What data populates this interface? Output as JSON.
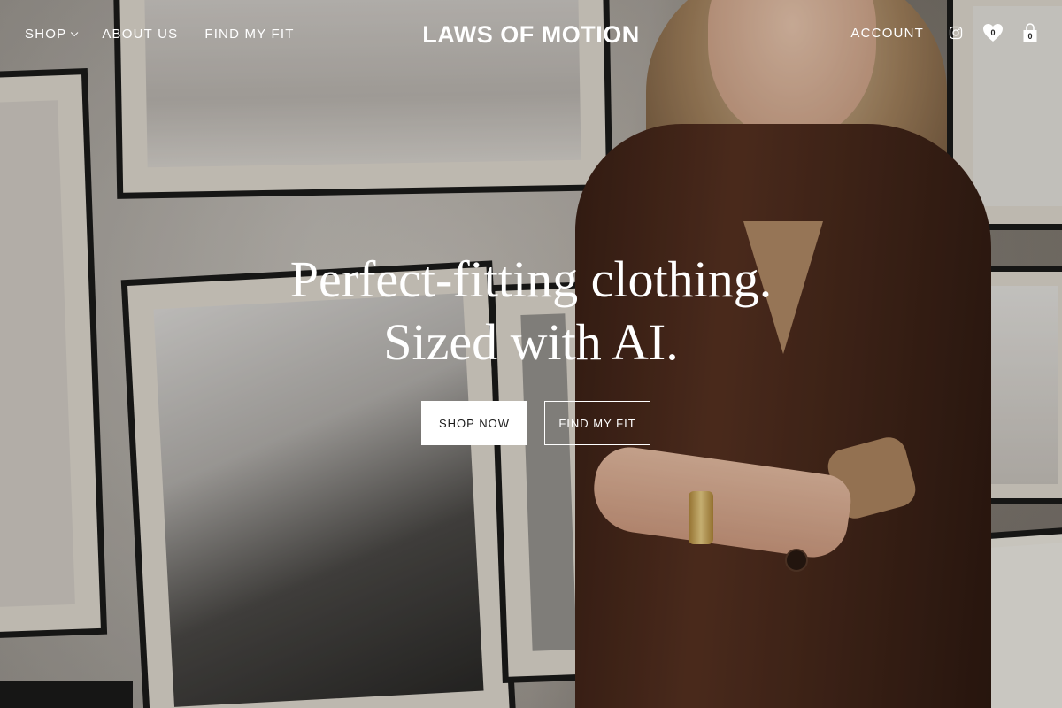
{
  "header": {
    "nav_left": [
      {
        "label": "SHOP",
        "has_dropdown": true
      },
      {
        "label": "ABOUT US"
      },
      {
        "label": "FIND MY FIT"
      }
    ],
    "logo": "LAWS OF MOTION",
    "account_label": "ACCOUNT",
    "icons": [
      "instagram-icon",
      "heart-icon",
      "shopping-bag-icon"
    ],
    "wishlist_count": "0",
    "cart_count": "0"
  },
  "hero": {
    "title": "Perfect-fitting clothing. Sized with AI.",
    "primary_button": "SHOP NOW",
    "secondary_button": "FIND MY FIT"
  },
  "colors": {
    "text": "#ffffff",
    "primary_button_bg": "#ffffff",
    "primary_button_text": "#1a1a1a"
  }
}
